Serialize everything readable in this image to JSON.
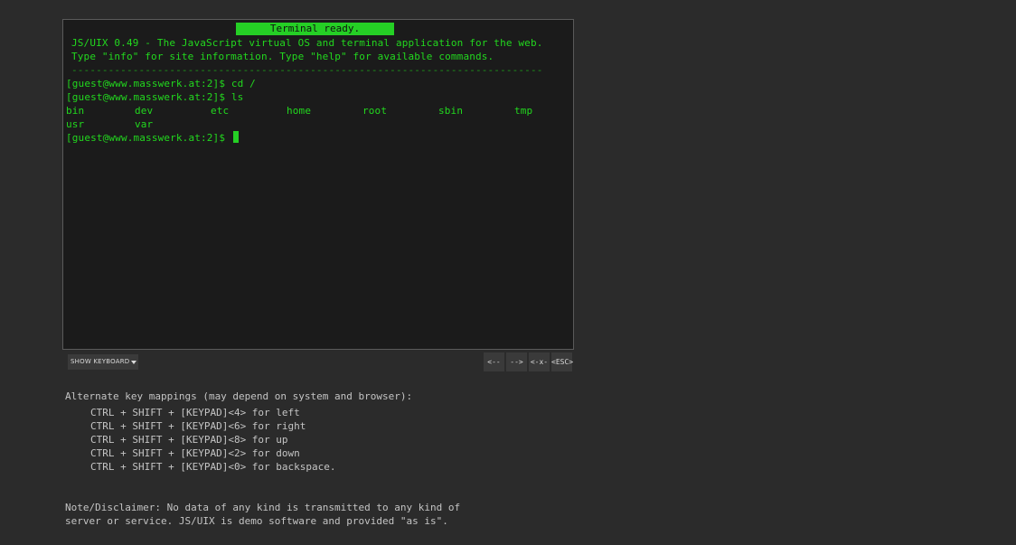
{
  "terminal": {
    "status": "Terminal ready.",
    "banner_line1": "JS/UIX 0.49 - The JavaScript virtual OS and terminal application for the web.",
    "banner_line2": "Type \"info\" for site information. Type \"help\" for available commands.",
    "separator": "-----------------------------------------------------------------------------",
    "history": [
      "[guest@www.masswerk.at:2]$ cd /",
      "[guest@www.masswerk.at:2]$ ls"
    ],
    "listing": [
      "bin",
      "dev",
      "etc",
      "home",
      "root",
      "sbin",
      "tmp",
      "usr",
      "var"
    ],
    "prompt": "[guest@www.masswerk.at:2]$"
  },
  "controls": {
    "show_keyboard_label": "SHOW KEYBOARD",
    "left_arrow_label": "<--",
    "right_arrow_label": "-->",
    "backspace_label": "<-x-",
    "esc_label": "<ESC>"
  },
  "mappings": {
    "heading": "Alternate key mappings (may depend on system and browser):",
    "items": [
      "CTRL + SHIFT + [KEYPAD]<4> for left",
      "CTRL + SHIFT + [KEYPAD]<6> for right",
      "CTRL + SHIFT + [KEYPAD]<8> for up",
      "CTRL + SHIFT + [KEYPAD]<2> for down",
      "CTRL + SHIFT + [KEYPAD]<0> for backspace."
    ]
  },
  "disclaimer": {
    "line1": "Note/Disclaimer: No data of any kind is transmitted to any kind of",
    "line2": "server or service. JS/UIX is demo software and provided \"as is\"."
  },
  "colors": {
    "background": "#2b2b2b",
    "terminal_bg": "#1b1b1b",
    "terminal_text": "#22d81e",
    "info_text": "#c4c4c4"
  }
}
